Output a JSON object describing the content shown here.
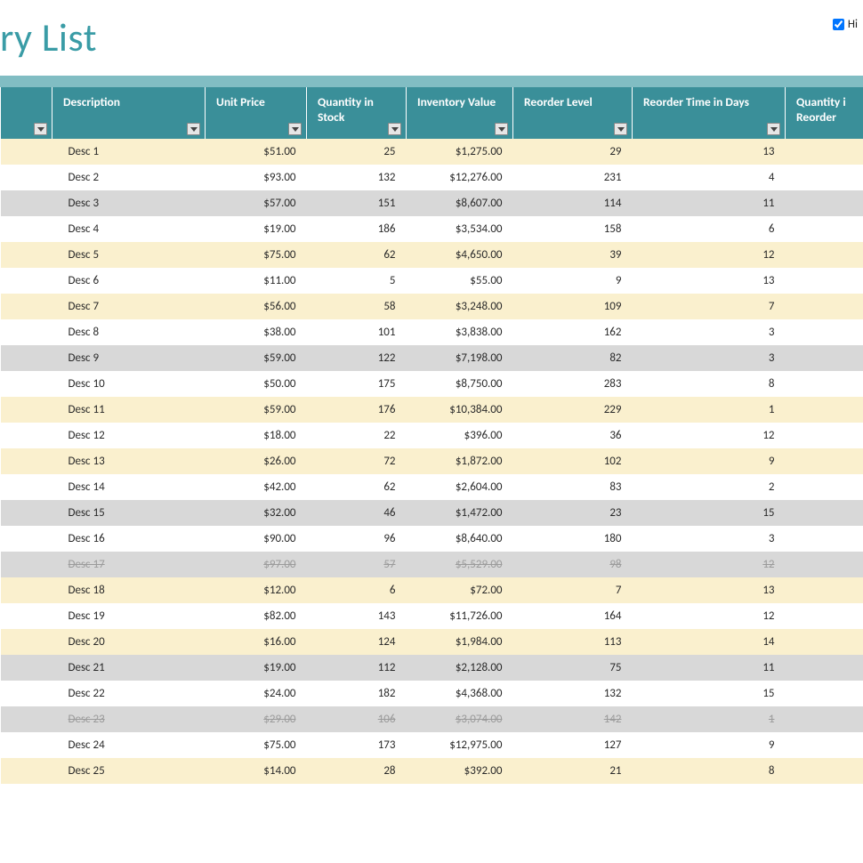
{
  "title": "ry List",
  "checkbox_label": "Hi",
  "columns": {
    "blank": "",
    "description": "Description",
    "unit_price": "Unit Price",
    "qty_stock": "Quantity in Stock",
    "inv_value": "Inventory Value",
    "reorder_level": "Reorder Level",
    "reorder_time": "Reorder Time in Days",
    "qty_reorder": "Quantity i Reorder"
  },
  "rows": [
    {
      "band": "cream",
      "strike": false,
      "desc": "Desc 1",
      "price": "$51.00",
      "qty": "25",
      "value": "$1,275.00",
      "reord": "29",
      "rtime": "13"
    },
    {
      "band": "white",
      "strike": false,
      "desc": "Desc 2",
      "price": "$93.00",
      "qty": "132",
      "value": "$12,276.00",
      "reord": "231",
      "rtime": "4"
    },
    {
      "band": "grey",
      "strike": false,
      "desc": "Desc 3",
      "price": "$57.00",
      "qty": "151",
      "value": "$8,607.00",
      "reord": "114",
      "rtime": "11"
    },
    {
      "band": "white",
      "strike": false,
      "desc": "Desc 4",
      "price": "$19.00",
      "qty": "186",
      "value": "$3,534.00",
      "reord": "158",
      "rtime": "6"
    },
    {
      "band": "cream",
      "strike": false,
      "desc": "Desc 5",
      "price": "$75.00",
      "qty": "62",
      "value": "$4,650.00",
      "reord": "39",
      "rtime": "12"
    },
    {
      "band": "white",
      "strike": false,
      "desc": "Desc 6",
      "price": "$11.00",
      "qty": "5",
      "value": "$55.00",
      "reord": "9",
      "rtime": "13"
    },
    {
      "band": "cream",
      "strike": false,
      "desc": "Desc 7",
      "price": "$56.00",
      "qty": "58",
      "value": "$3,248.00",
      "reord": "109",
      "rtime": "7"
    },
    {
      "band": "white",
      "strike": false,
      "desc": "Desc 8",
      "price": "$38.00",
      "qty": "101",
      "value": "$3,838.00",
      "reord": "162",
      "rtime": "3"
    },
    {
      "band": "grey",
      "strike": false,
      "desc": "Desc 9",
      "price": "$59.00",
      "qty": "122",
      "value": "$7,198.00",
      "reord": "82",
      "rtime": "3"
    },
    {
      "band": "white",
      "strike": false,
      "desc": "Desc 10",
      "price": "$50.00",
      "qty": "175",
      "value": "$8,750.00",
      "reord": "283",
      "rtime": "8"
    },
    {
      "band": "cream",
      "strike": false,
      "desc": "Desc 11",
      "price": "$59.00",
      "qty": "176",
      "value": "$10,384.00",
      "reord": "229",
      "rtime": "1"
    },
    {
      "band": "white",
      "strike": false,
      "desc": "Desc 12",
      "price": "$18.00",
      "qty": "22",
      "value": "$396.00",
      "reord": "36",
      "rtime": "12"
    },
    {
      "band": "cream",
      "strike": false,
      "desc": "Desc 13",
      "price": "$26.00",
      "qty": "72",
      "value": "$1,872.00",
      "reord": "102",
      "rtime": "9"
    },
    {
      "band": "white",
      "strike": false,
      "desc": "Desc 14",
      "price": "$42.00",
      "qty": "62",
      "value": "$2,604.00",
      "reord": "83",
      "rtime": "2"
    },
    {
      "band": "grey",
      "strike": false,
      "desc": "Desc 15",
      "price": "$32.00",
      "qty": "46",
      "value": "$1,472.00",
      "reord": "23",
      "rtime": "15"
    },
    {
      "band": "white",
      "strike": false,
      "desc": "Desc 16",
      "price": "$90.00",
      "qty": "96",
      "value": "$8,640.00",
      "reord": "180",
      "rtime": "3"
    },
    {
      "band": "grey",
      "strike": true,
      "desc": "Desc 17",
      "price": "$97.00",
      "qty": "57",
      "value": "$5,529.00",
      "reord": "98",
      "rtime": "12"
    },
    {
      "band": "cream",
      "strike": false,
      "desc": "Desc 18",
      "price": "$12.00",
      "qty": "6",
      "value": "$72.00",
      "reord": "7",
      "rtime": "13"
    },
    {
      "band": "white",
      "strike": false,
      "desc": "Desc 19",
      "price": "$82.00",
      "qty": "143",
      "value": "$11,726.00",
      "reord": "164",
      "rtime": "12"
    },
    {
      "band": "cream",
      "strike": false,
      "desc": "Desc 20",
      "price": "$16.00",
      "qty": "124",
      "value": "$1,984.00",
      "reord": "113",
      "rtime": "14"
    },
    {
      "band": "grey",
      "strike": false,
      "desc": "Desc 21",
      "price": "$19.00",
      "qty": "112",
      "value": "$2,128.00",
      "reord": "75",
      "rtime": "11"
    },
    {
      "band": "white",
      "strike": false,
      "desc": "Desc 22",
      "price": "$24.00",
      "qty": "182",
      "value": "$4,368.00",
      "reord": "132",
      "rtime": "15"
    },
    {
      "band": "grey",
      "strike": true,
      "desc": "Desc 23",
      "price": "$29.00",
      "qty": "106",
      "value": "$3,074.00",
      "reord": "142",
      "rtime": "1"
    },
    {
      "band": "white",
      "strike": false,
      "desc": "Desc 24",
      "price": "$75.00",
      "qty": "173",
      "value": "$12,975.00",
      "reord": "127",
      "rtime": "9"
    },
    {
      "band": "cream",
      "strike": false,
      "desc": "Desc 25",
      "price": "$14.00",
      "qty": "28",
      "value": "$392.00",
      "reord": "21",
      "rtime": "8"
    }
  ]
}
